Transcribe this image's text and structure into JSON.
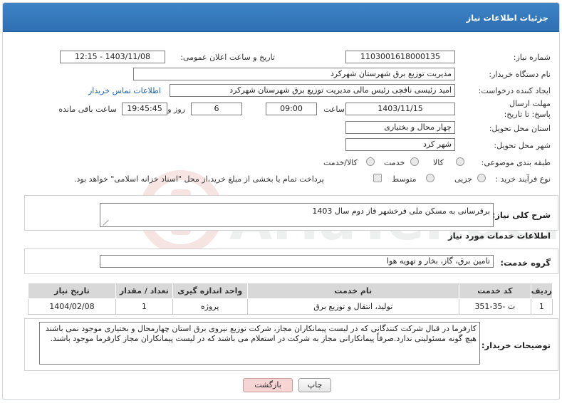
{
  "header": {
    "title": "جزئیات اطلاعات نیاز"
  },
  "fields": {
    "need_number_label": "شماره نیاز:",
    "need_number": "1103001618000135",
    "announce_datetime_label": "تاریخ و ساعت اعلان عمومی:",
    "announce_datetime": "1403/11/08 - 12:15",
    "buyer_org_label": "نام دستگاه خریدار:",
    "buyer_org": "مدیریت توزیع برق شهرستان شهرکرد",
    "requester_label": "ایجاد کننده درخواست:",
    "requester": "امید رئیسی نافچی رئیس مالی مدیریت توزیع برق شهرستان شهرکرد",
    "buyer_contact_link": "اطلاعات تماس خریدار",
    "deadline_label": "مهلت ارسال پاسخ: تا تاریخ:",
    "deadline_date": "1403/11/15",
    "time_label": "ساعت",
    "deadline_time": "09:00",
    "days_value": "6",
    "days_label": "روز و",
    "remaining_time": "19:45:45",
    "remaining_label": "ساعت باقی مانده",
    "province_label": "استان محل تحویل:",
    "province": "چهار محال و بختیاری",
    "city_label": "شهر محل تحویل:",
    "city": "شهر کرد",
    "category_label": "طبقه بندی موضوعی:",
    "category_options": [
      "کالا",
      "خدمت",
      "کالا/خدمت"
    ],
    "process_label": "نوع فرآیند خرید :",
    "process_options": [
      "جزیی",
      "متوسط"
    ],
    "payment_note": "پرداخت تمام یا بخشی از مبلغ خرید،از محل \"اسناد خزانه اسلامی\" خواهد بود."
  },
  "summary": {
    "label": "شرح کلی نیاز:",
    "value": "برقرسانی به مسکن ملی فرخشهر فاز دوم سال 1403"
  },
  "services": {
    "section_title": "اطلاعات خدمات مورد نیاز",
    "group_label": "گروه خدمت:",
    "group_value": "تامین برق، گاز، بخار و تهویه هوا",
    "columns": [
      "ردیف",
      "کد خدمت",
      "نام خدمت",
      "واحد اندازه گیری",
      "تعداد / مقدار",
      "تاریخ نیاز"
    ],
    "rows": [
      [
        "1",
        "ت -35-351",
        "تولید، انتقال و توزیع برق",
        "پروژه",
        "1",
        "1404/02/08"
      ]
    ]
  },
  "buyer_notes": {
    "label": "توضیحات خریدار:",
    "value": "کارفرما در قبال شرکت کنندگانی که در لیست پیمانکاران مجاز، شرکت توزیع نیروی برق استان چهارمحال و بختیاری موجود نمی باشند هیچ گونه مسئولیتی ندارد.صرفاً پیمانکارانی مجاز به شرکت در استعلام می باشند که در لیست پیمانکاران مجاز کارفرما موجود باشند."
  },
  "buttons": {
    "print": "چاپ",
    "back": "بازگشت"
  },
  "colors": {
    "header": "#3d84c6",
    "link": "#1a62b0",
    "back_button": "#f7d5d5"
  }
}
